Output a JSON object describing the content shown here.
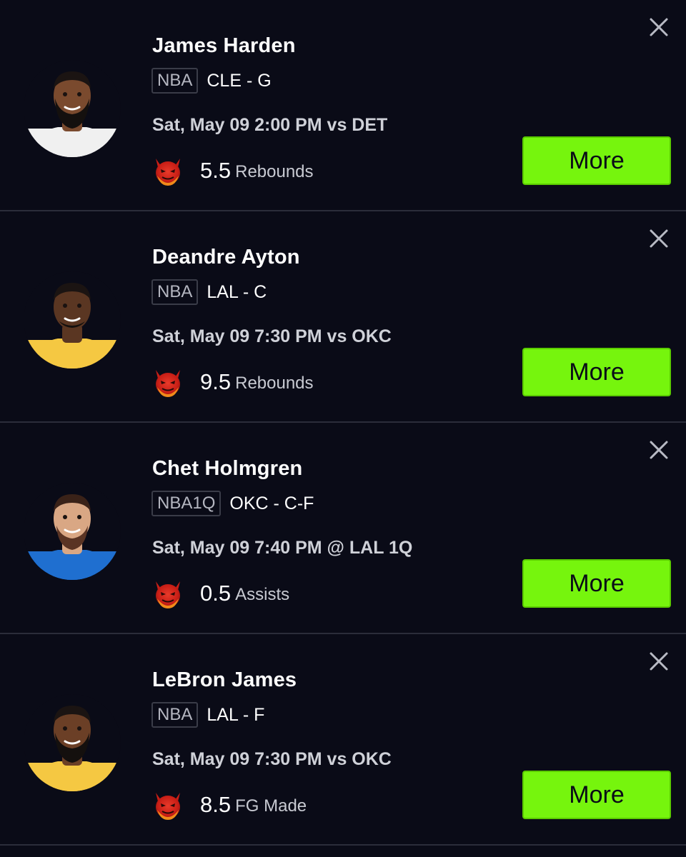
{
  "players": [
    {
      "name": "James Harden",
      "league": "NBA",
      "team_position": "CLE - G",
      "game": "Sat, May 09 2:00 PM vs DET",
      "line": "5.5",
      "stat": "Rebounds",
      "more_label": "More",
      "jersey_color": "#f0f0f0",
      "skin_color": "#7a4a2e",
      "hair": "beard"
    },
    {
      "name": "Deandre Ayton",
      "league": "NBA",
      "team_position": "LAL - C",
      "game": "Sat, May 09 7:30 PM vs OKC",
      "line": "9.5",
      "stat": "Rebounds",
      "more_label": "More",
      "jersey_color": "#f5c842",
      "skin_color": "#5a3622",
      "hair": "short"
    },
    {
      "name": "Chet Holmgren",
      "league": "NBA1Q",
      "team_position": "OKC - C-F",
      "game": "Sat, May 09 7:40 PM @ LAL 1Q",
      "line": "0.5",
      "stat": "Assists",
      "more_label": "More",
      "jersey_color": "#1f6fd0",
      "skin_color": "#d9a784",
      "hair": "brown"
    },
    {
      "name": "LeBron James",
      "league": "NBA",
      "team_position": "LAL - F",
      "game": "Sat, May 09 7:30 PM vs OKC",
      "line": "8.5",
      "stat": "FG Made",
      "more_label": "More",
      "jersey_color": "#f5c842",
      "skin_color": "#6b3f26",
      "hair": "beard"
    }
  ],
  "colors": {
    "background": "#0a0b17",
    "divider": "#2b2d3a",
    "more_button": "#76f50d",
    "devil_red": "#e0271f",
    "devil_orange": "#f08a1a"
  },
  "icons": {
    "close": "close-icon",
    "devil": "devil-emoji-icon",
    "avatar": "player-headshot"
  }
}
